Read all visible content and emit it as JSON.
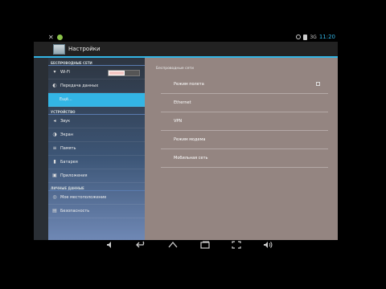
{
  "statusbar": {
    "time": "11:20",
    "signal": "3G",
    "alarm_icon": "alarm-icon",
    "battery_icon": "battery-icon"
  },
  "actionbar": {
    "title": "Настройки",
    "icon": "settings-app-icon"
  },
  "sidebar": {
    "sections": {
      "wireless": "БЕСПРОВОДНЫЕ СЕТИ",
      "device": "УСТРОЙСТВО",
      "personal": "ЛИЧНЫЕ ДАННЫЕ"
    },
    "items": [
      {
        "label": "Wi-Fi",
        "icon": "wifi-icon"
      },
      {
        "label": "Передача данных",
        "icon": "data-usage-icon"
      },
      {
        "label": "Ещё...",
        "icon": ""
      },
      {
        "label": "Звук",
        "icon": "volume-icon"
      },
      {
        "label": "Экран",
        "icon": "brightness-icon"
      },
      {
        "label": "Память",
        "icon": "storage-icon"
      },
      {
        "label": "Батарея",
        "icon": "battery-icon"
      },
      {
        "label": "Приложения",
        "icon": "apps-icon"
      },
      {
        "label": "Мое местоположение",
        "icon": "location-icon"
      },
      {
        "label": "Безопасность",
        "icon": "lock-icon"
      }
    ],
    "wifi_toggle_state": "on"
  },
  "panel": {
    "header": "Беспроводные сети",
    "items": [
      {
        "label": "Режим полета",
        "checkbox": false
      },
      {
        "label": "Ethernet"
      },
      {
        "label": "VPN"
      },
      {
        "label": "Режим модема"
      },
      {
        "label": "Мобильная сеть"
      }
    ]
  },
  "navbar": [
    "volume-down-icon",
    "back-icon",
    "home-icon",
    "recent-apps-icon",
    "screenshot-icon",
    "volume-up-icon"
  ]
}
